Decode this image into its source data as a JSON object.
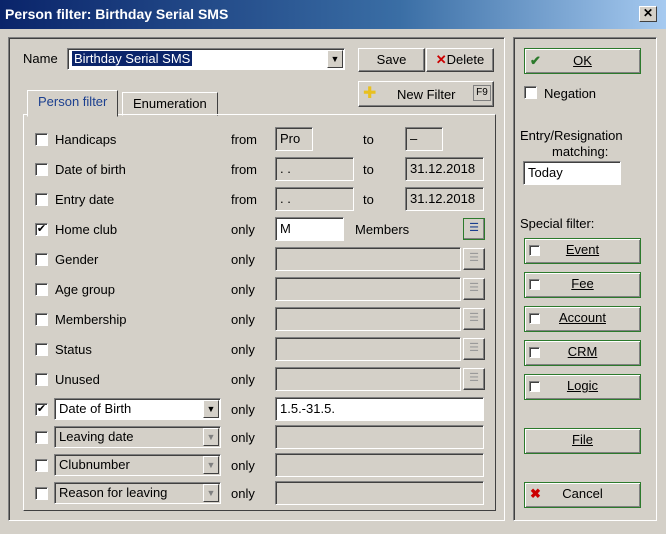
{
  "window": {
    "title": "Person filter: Birthday Serial SMS",
    "close_glyph": "✕"
  },
  "header": {
    "name_label": "Name",
    "name_value": "Birthday Serial SMS",
    "save_label": "Save",
    "delete_label": "Delete",
    "new_filter_label": "New Filter",
    "new_filter_shortcut": "F9"
  },
  "tabs": [
    {
      "label": "Person filter",
      "active": true
    },
    {
      "label": "Enumeration",
      "active": false
    }
  ],
  "rows": [
    {
      "label": "Handicaps",
      "checked": false,
      "op": "from",
      "value": "Pro",
      "to_label": "to",
      "to_value": "–"
    },
    {
      "label": "Date of birth",
      "checked": false,
      "op": "from",
      "value": " . .",
      "to_label": "to",
      "to_value": "31.12.2018"
    },
    {
      "label": "Entry date",
      "checked": false,
      "op": "from",
      "value": " . .",
      "to_label": "to",
      "to_value": "31.12.2018"
    },
    {
      "label": "Home club",
      "checked": true,
      "op": "only",
      "value": "M",
      "suffix": "Members"
    },
    {
      "label": "Gender",
      "checked": false,
      "op": "only",
      "value": ""
    },
    {
      "label": "Age group",
      "checked": false,
      "op": "only",
      "value": ""
    },
    {
      "label": "Membership",
      "checked": false,
      "op": "only",
      "value": ""
    },
    {
      "label": "Status",
      "checked": false,
      "op": "only",
      "value": ""
    },
    {
      "label": "Unused",
      "checked": false,
      "op": "only",
      "value": ""
    }
  ],
  "combo_rows": [
    {
      "selected": "Date of Birth",
      "checked": true,
      "op": "only",
      "value": "1.5.-31.5."
    },
    {
      "selected": "Leaving date",
      "checked": false,
      "op": "only",
      "value": ""
    },
    {
      "selected": "Clubnumber",
      "checked": false,
      "op": "only",
      "value": ""
    },
    {
      "selected": "Reason for leaving",
      "checked": false,
      "op": "only",
      "value": ""
    }
  ],
  "right": {
    "ok_label": "OK",
    "negation_label": "Negation",
    "entry_label_line1": "Entry/Resignation",
    "entry_label_line2": "matching:",
    "entry_value": "Today",
    "special_filter_label": "Special filter:",
    "special_buttons": [
      "Event",
      "Fee",
      "Account",
      "CRM",
      "Logic"
    ],
    "file_label": "File",
    "cancel_label": "Cancel"
  },
  "colors": {
    "accent_green": "#2c7a2c",
    "accent_blue": "#1b3f8f",
    "cancel_red": "#cc0000"
  }
}
